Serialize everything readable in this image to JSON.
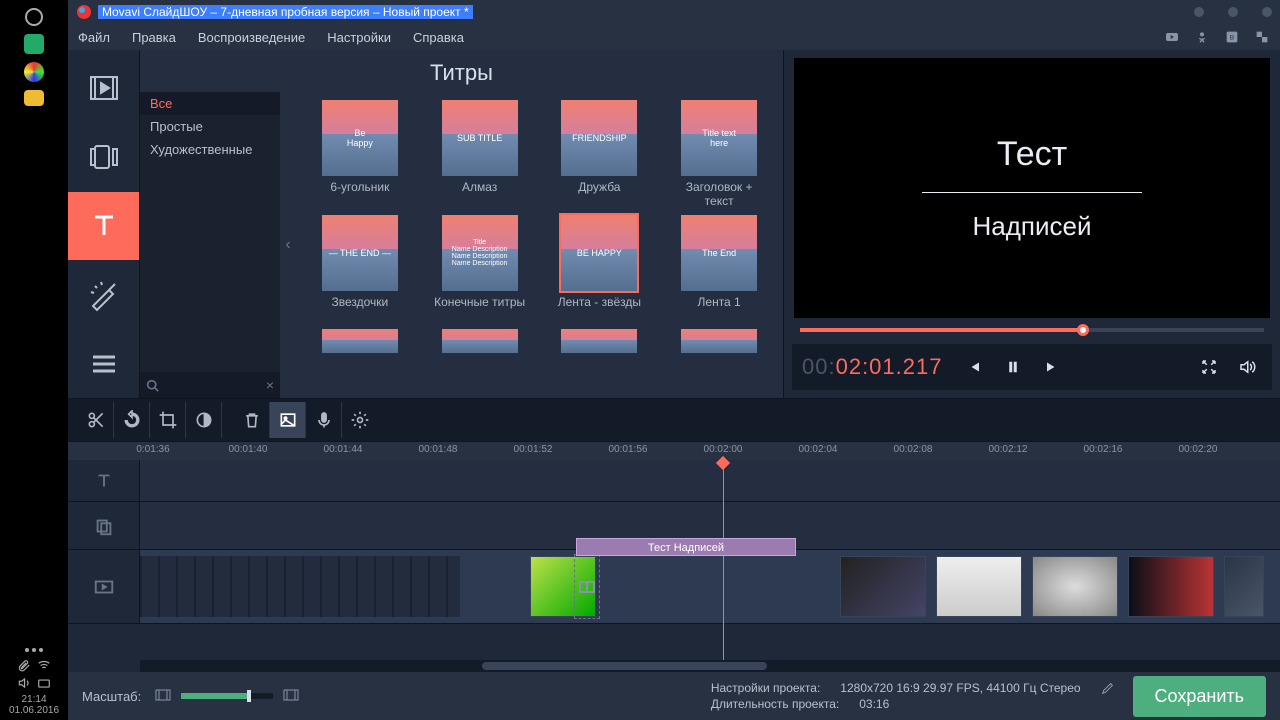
{
  "desktop": {
    "time": "21:14",
    "date": "01.06.2016"
  },
  "titlebar": {
    "title": "Movavi СлайдШОУ – 7-дневная пробная версия – Новый проект *"
  },
  "menu": {
    "items": [
      "Файл",
      "Правка",
      "Воспроизведение",
      "Настройки",
      "Справка"
    ]
  },
  "panel": {
    "title": "Титры",
    "categories": [
      "Все",
      "Простые",
      "Художественные"
    ],
    "active_category": 0,
    "items": [
      {
        "label": "6-угольник",
        "ov": "Be\nHappy"
      },
      {
        "label": "Алмаз",
        "ov": "SUB TITLE"
      },
      {
        "label": "Дружба",
        "ov": "FRIENDSHIP"
      },
      {
        "label": "Заголовок + текст",
        "ov": "Title text\nhere"
      },
      {
        "label": "Звездочки",
        "ov": "— THE END —"
      },
      {
        "label": "Конечные титры",
        "ov": "Title\nName Description\nName Description\nName Description"
      },
      {
        "label": "Лента - звёзды",
        "ov": "BE HAPPY"
      },
      {
        "label": "Лента 1",
        "ov": "The End"
      }
    ]
  },
  "preview": {
    "line1": "Тест",
    "line2": "Надписей",
    "timecode_dim1": "00:",
    "timecode_red": "02:01.",
    "timecode_dim2": "217"
  },
  "timeline": {
    "ticks": [
      "0:01:36",
      "00:01:40",
      "00:01:44",
      "00:01:48",
      "00:01:52",
      "00:01:56",
      "00:02:00",
      "00:02:04",
      "00:02:08",
      "00:02:12",
      "00:02:16",
      "00:02:20"
    ],
    "title_clip": "Тест Надписей"
  },
  "footer": {
    "zoom_label": "Масштаб:",
    "settings_label": "Настройки проекта:",
    "settings_value": "1280x720 16:9 29.97 FPS, 44100 Гц Стерео",
    "duration_label": "Длительность проекта:",
    "duration_value": "03:16",
    "save": "Сохранить"
  }
}
